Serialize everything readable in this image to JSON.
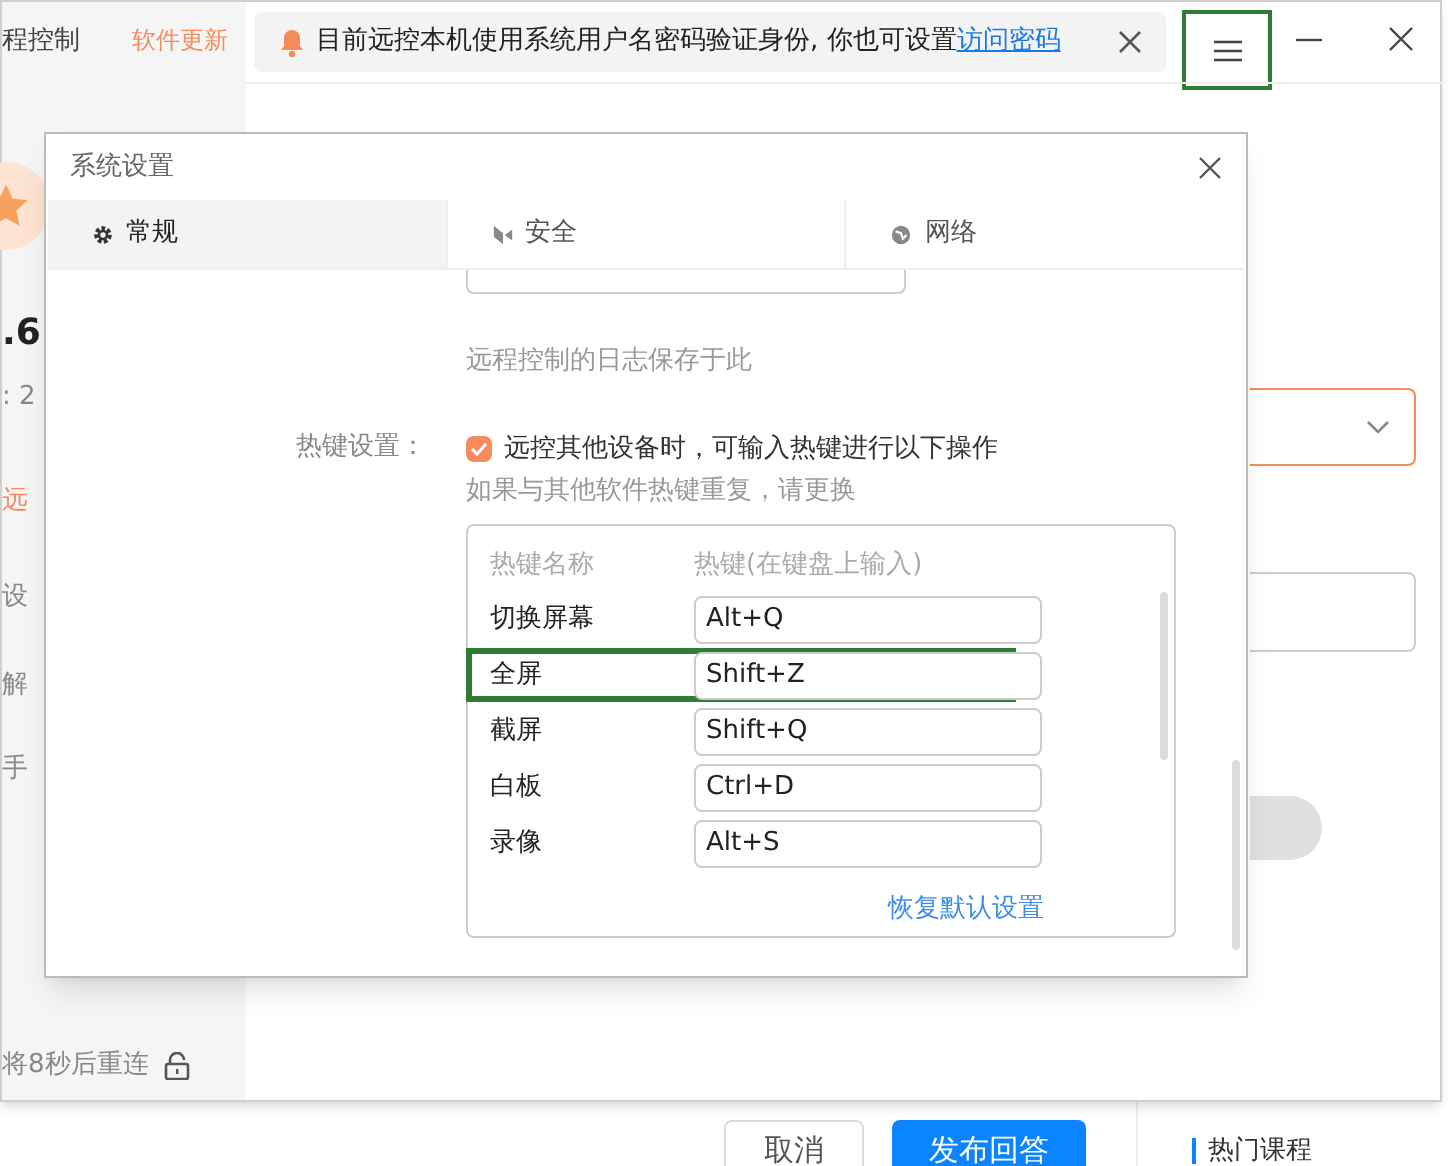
{
  "web_page": {
    "buttons": [
      {
        "label": "取消",
        "kind": "secondary"
      },
      {
        "label": "发布回答",
        "kind": "primary"
      }
    ],
    "sidebar_heading": "热门课程"
  },
  "app": {
    "title_fragment": "程控制",
    "update_link": "软件更新",
    "notice": {
      "text": "目前远控本机使用系统用户名密码验证身份, 你也可设置",
      "link": "访问密码"
    },
    "menu_highlighted": true,
    "sidebar_fragments": [
      {
        "text": ".6",
        "kind": "value"
      },
      {
        "text": ": 2",
        "kind": "muted"
      },
      {
        "text": "远",
        "kind": "accent"
      },
      {
        "text": "设",
        "kind": "muted"
      },
      {
        "text": "解",
        "kind": "muted"
      },
      {
        "text": "手",
        "kind": "muted"
      }
    ],
    "status": "将8秒后重连"
  },
  "dialog": {
    "title": "系统设置",
    "tabs": [
      {
        "label": "常规",
        "selected": true
      },
      {
        "label": "安全",
        "selected": false
      },
      {
        "label": "网络",
        "selected": false
      }
    ],
    "log_hint": "远程控制的日志保存于此",
    "hotkey_label": "热键设置：",
    "hotkey_enable": {
      "label": "远控其他设备时，可输入热键进行以下操作",
      "checked": true
    },
    "hotkey_hint": "如果与其他软件热键重复，请更换",
    "columns": [
      "热键名称",
      "热键(在键盘上输入)"
    ],
    "hotkeys": [
      {
        "name": "切换屏幕",
        "value": "Alt+Q",
        "highlighted": false
      },
      {
        "name": "全屏",
        "value": "Shift+Z",
        "highlighted": true
      },
      {
        "name": "截屏",
        "value": "Shift+Q",
        "highlighted": false
      },
      {
        "name": "白板",
        "value": "Ctrl+D",
        "highlighted": false
      },
      {
        "name": "录像",
        "value": "Alt+S",
        "highlighted": false
      }
    ],
    "restore_link": "恢复默认设置"
  }
}
